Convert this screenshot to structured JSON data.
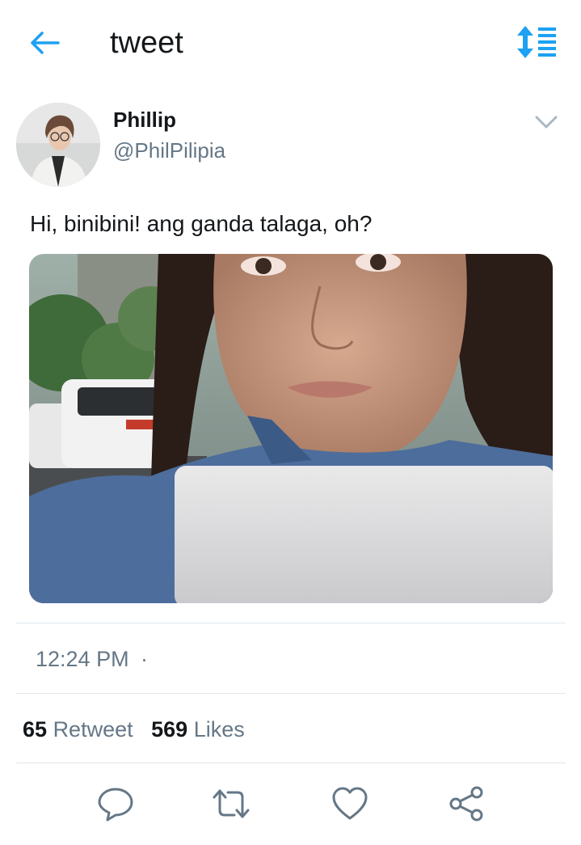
{
  "header": {
    "title": "tweet",
    "back_icon": "arrow-left-icon",
    "sort_icon": "sort-list-icon",
    "accent": "#1da1f2"
  },
  "author": {
    "name": "Phillip",
    "handle": "@PhilPilipia",
    "avatar_icon": "avatar",
    "menu_icon": "chevron-down-icon"
  },
  "tweet": {
    "text": "Hi, binibini! ang ganda talaga, oh?",
    "media": "photo"
  },
  "meta": {
    "time": "12:24 PM",
    "separator": "·"
  },
  "stats": {
    "retweets_count": "65",
    "retweets_label": "Retweet",
    "likes_count": "569",
    "likes_label": "Likes"
  },
  "actions": [
    {
      "name": "reply",
      "icon": "reply-icon"
    },
    {
      "name": "retweet",
      "icon": "retweet-icon"
    },
    {
      "name": "like",
      "icon": "heart-icon"
    },
    {
      "name": "share",
      "icon": "share-icon"
    }
  ],
  "colors": {
    "text_primary": "#14171a",
    "text_secondary": "#657786",
    "divider": "#e1e8ed",
    "icon": "#657786"
  }
}
